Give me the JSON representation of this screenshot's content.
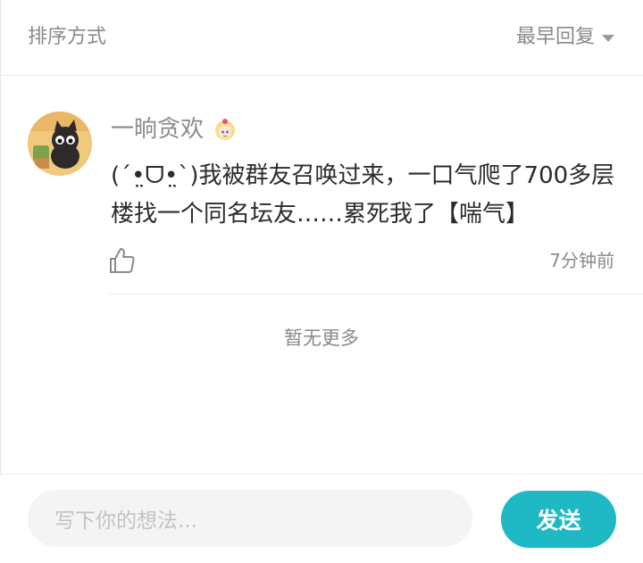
{
  "sort": {
    "label": "排序方式",
    "selected": "最早回复",
    "caret_icon": "caret-down-icon"
  },
  "comment": {
    "avatar_icon": "black-cat-avatar",
    "username": "一晌贪欢",
    "badge_icon": "anime-girl-badge-icon",
    "text": "(ˊ•̤ᗜ•̤ˋ)我被群友召唤过来，一口气爬了700多层楼找一个同名坛友……累死我了【喘气】",
    "like_icon": "thumbs-up-icon",
    "time": "7分钟前"
  },
  "footer": {
    "no_more": "暂无更多"
  },
  "reply": {
    "placeholder": "写下你的想法...",
    "send_label": "发送"
  },
  "colors": {
    "accent": "#1fb8c5",
    "muted_text": "#8a8a8a",
    "body_text": "#2b2b2b",
    "input_bg": "#f4f4f4"
  }
}
